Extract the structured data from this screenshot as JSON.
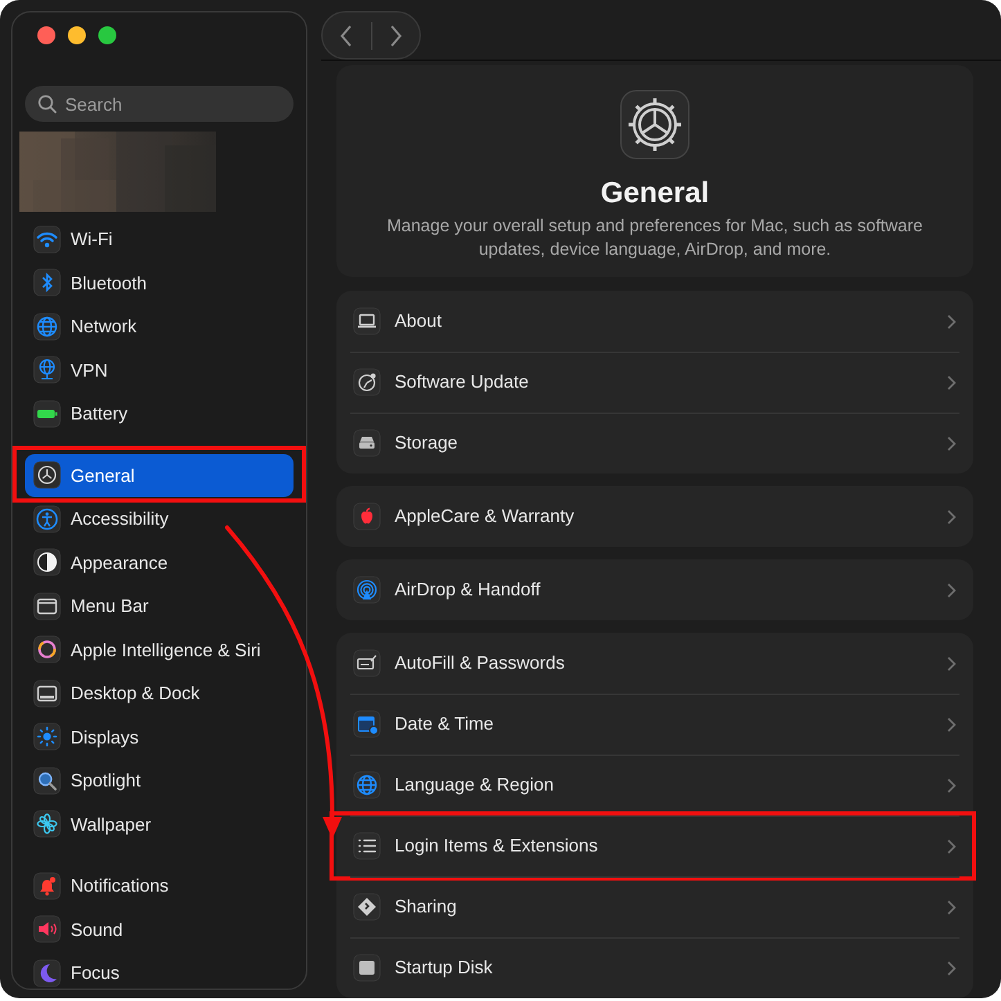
{
  "sidebar": {
    "search": {
      "placeholder": "Search"
    },
    "account": {
      "kind": "picture"
    },
    "groups": [
      [
        {
          "label": "Wi-Fi",
          "selected": false,
          "highlighted": false
        },
        {
          "label": "Bluetooth",
          "selected": false,
          "highlighted": false
        },
        {
          "label": "Network",
          "selected": false,
          "highlighted": false
        },
        {
          "label": "VPN",
          "selected": false,
          "highlighted": false
        },
        {
          "label": "Battery",
          "selected": false,
          "highlighted": false
        }
      ],
      [
        {
          "label": "General",
          "selected": true,
          "highlighted": true
        },
        {
          "label": "Accessibility",
          "selected": false,
          "highlighted": false
        },
        {
          "label": "Appearance",
          "selected": false,
          "highlighted": false
        },
        {
          "label": "Menu Bar",
          "selected": false,
          "highlighted": false
        },
        {
          "label": "Apple Intelligence & Siri",
          "selected": false,
          "highlighted": false
        },
        {
          "label": "Desktop & Dock",
          "selected": false,
          "highlighted": false
        },
        {
          "label": "Displays",
          "selected": false,
          "highlighted": false
        },
        {
          "label": "Spotlight",
          "selected": false,
          "highlighted": false
        },
        {
          "label": "Wallpaper",
          "selected": false,
          "highlighted": false
        }
      ],
      [
        {
          "label": "Notifications",
          "selected": false,
          "highlighted": false
        },
        {
          "label": "Sound",
          "selected": false,
          "highlighted": false
        },
        {
          "label": "Focus",
          "selected": false,
          "highlighted": false
        }
      ]
    ]
  },
  "header": {
    "title": "General",
    "description": "Manage your overall setup and preferences for Mac, such as software updates, device language, AirDrop, and more."
  },
  "sections": [
    [
      {
        "label": "About",
        "highlighted": false
      },
      {
        "label": "Software Update",
        "highlighted": false
      },
      {
        "label": "Storage",
        "highlighted": false
      }
    ],
    [
      {
        "label": "AppleCare & Warranty",
        "highlighted": false
      }
    ],
    [
      {
        "label": "AirDrop & Handoff",
        "highlighted": false
      }
    ],
    [
      {
        "label": "AutoFill & Passwords",
        "highlighted": false
      },
      {
        "label": "Date & Time",
        "highlighted": false
      },
      {
        "label": "Language & Region",
        "highlighted": false
      },
      {
        "label": "Login Items & Extensions",
        "highlighted": true
      },
      {
        "label": "Sharing",
        "highlighted": false
      },
      {
        "label": "Startup Disk",
        "highlighted": false
      }
    ]
  ],
  "annotation_arrow": true
}
